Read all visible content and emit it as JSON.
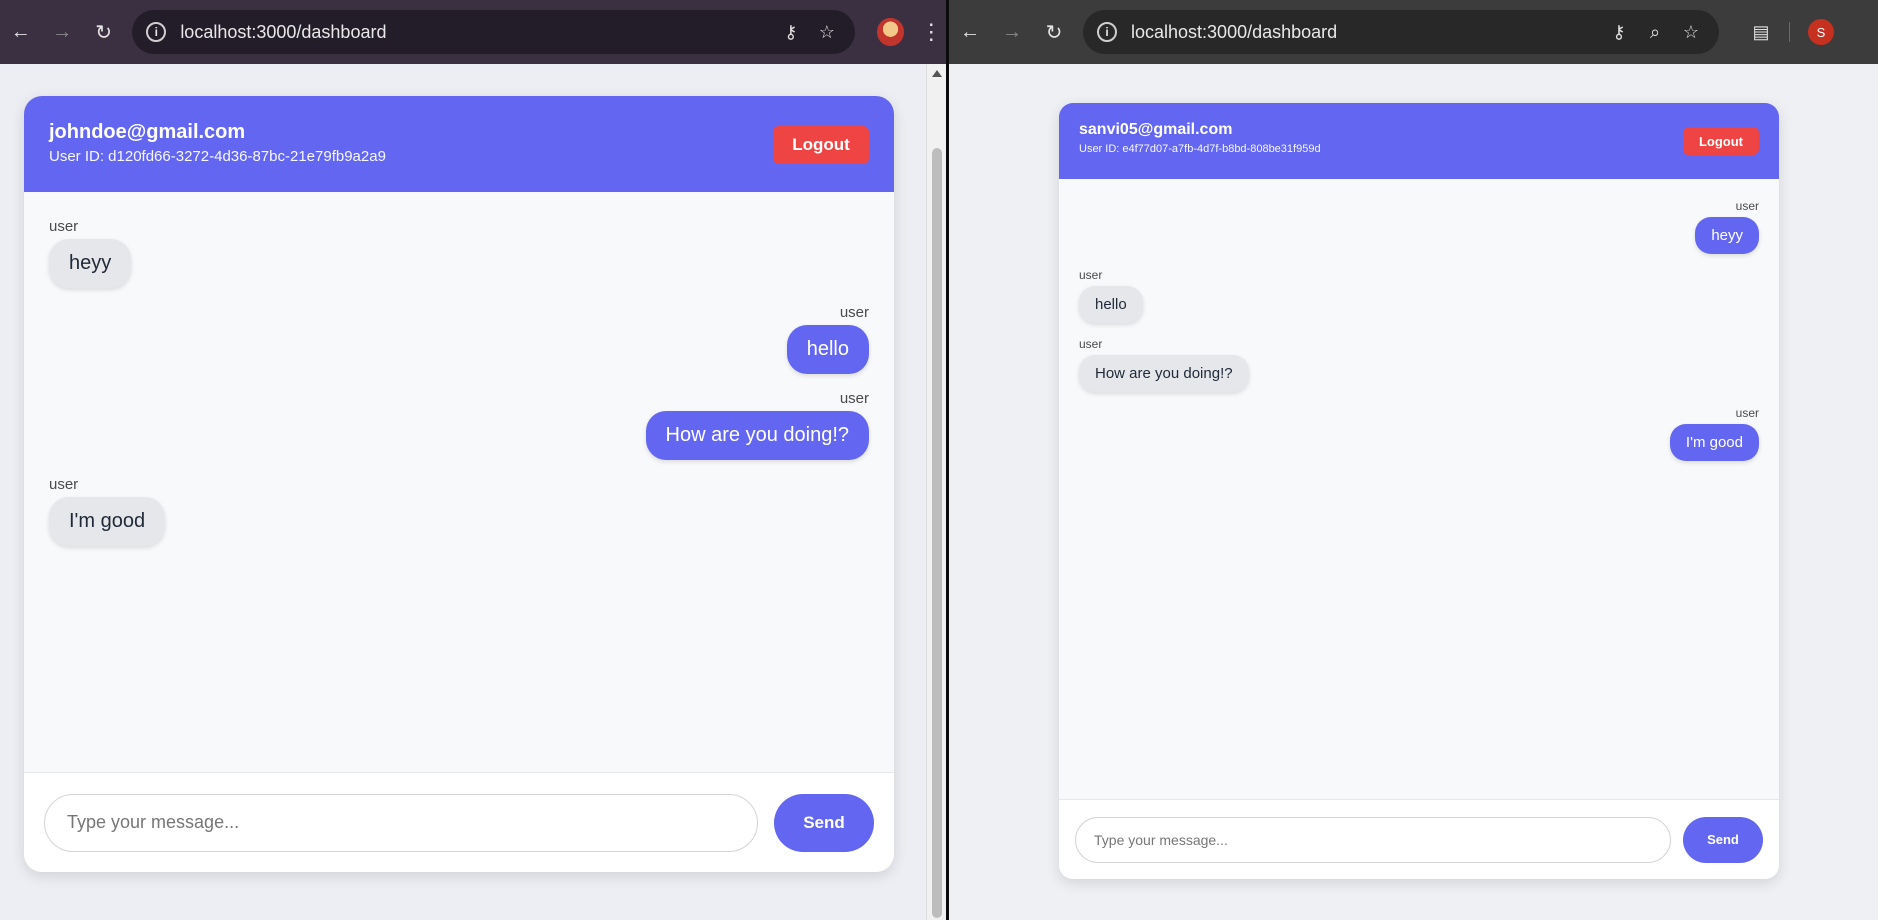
{
  "left": {
    "url": "localhost:3000/dashboard",
    "user": {
      "email": "johndoe@gmail.com",
      "user_id": "User ID: d120fd66-3272-4d36-87bc-21e79fb9a2a9"
    },
    "logout_label": "Logout",
    "messages": [
      {
        "sender": "user",
        "text": "heyy"
      },
      {
        "sender": "user",
        "text": "hello"
      },
      {
        "sender": "user",
        "text": "How are you doing!?"
      },
      {
        "sender": "user",
        "text": "I'm good"
      }
    ],
    "input_placeholder": "Type your message...",
    "send_label": "Send",
    "icons": [
      "back-icon",
      "forward-icon",
      "reload-icon",
      "info-icon",
      "key-icon",
      "star-icon",
      "profile-avatar-icon",
      "menu-icon"
    ]
  },
  "right": {
    "url": "localhost:3000/dashboard",
    "user": {
      "email": "sanvi05@gmail.com",
      "user_id": "User ID: e4f77d07-a7fb-4d7f-b8bd-808be31f959d"
    },
    "logout_label": "Logout",
    "messages": [
      {
        "sender": "user",
        "text": "heyy"
      },
      {
        "sender": "user",
        "text": "hello"
      },
      {
        "sender": "user",
        "text": "How are you doing!?"
      },
      {
        "sender": "user",
        "text": "I'm good"
      }
    ],
    "input_placeholder": "Type your message...",
    "send_label": "Send",
    "profile_initial": "S",
    "icons": [
      "back-icon",
      "forward-icon",
      "reload-icon",
      "info-icon",
      "key-icon",
      "zoom-icon",
      "star-icon",
      "extensions-icon",
      "profile-avatar-icon"
    ]
  },
  "colors": {
    "accent": "#6366f1",
    "logout": "#ef4444",
    "incoming_bubble": "#e5e7eb"
  }
}
